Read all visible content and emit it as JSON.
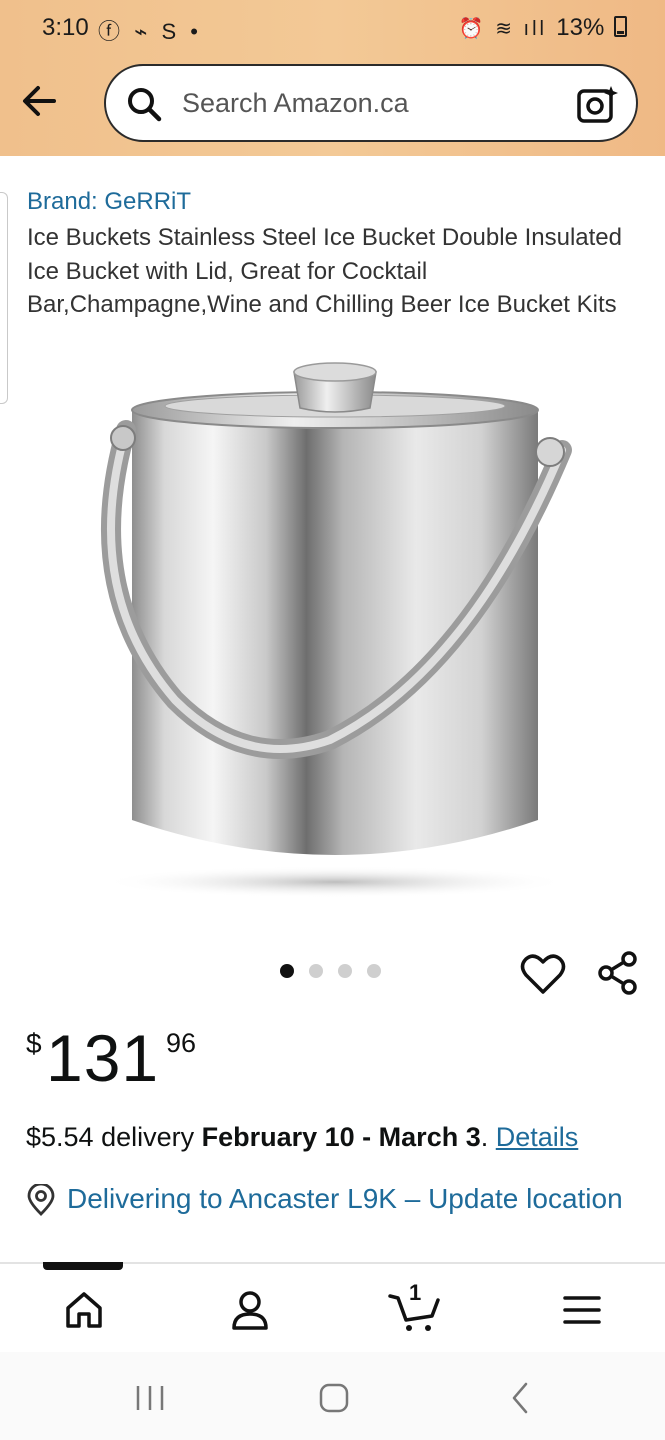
{
  "status_bar": {
    "time": "3:10",
    "left_icons": "ⓕ ⌁ S •",
    "right_glyphs": "⏰ ≋ ıll",
    "battery": "13%"
  },
  "header": {
    "back_icon": "arrow-left-icon",
    "search_placeholder": "Search Amazon.ca",
    "camera_icon": "camera-lens-icon"
  },
  "product": {
    "brand": "Brand: GeRRiT",
    "title": "Ice Buckets Stainless Steel Ice Bucket Double Insulated Ice Bucket with Lid, Great for Cocktail Bar,Champagne,Wine and Chilling Beer Ice Bucket Kits",
    "image_carousel": {
      "total": 4,
      "active_index": 0
    },
    "price": {
      "symbol": "$",
      "whole": "131",
      "fraction": "96"
    },
    "delivery": {
      "prefix": "$5.54 delivery ",
      "dates": "February 10 - March 3",
      "suffix": ". ",
      "details_link": "Details"
    },
    "location": "Delivering to Ancaster L9K – Update location"
  },
  "bottom_nav": {
    "items": [
      "home-icon",
      "account-icon",
      "cart-icon",
      "menu-icon"
    ],
    "cart_count": "1"
  },
  "colors": {
    "header": "#f3c996",
    "link": "#1e6b9a"
  }
}
